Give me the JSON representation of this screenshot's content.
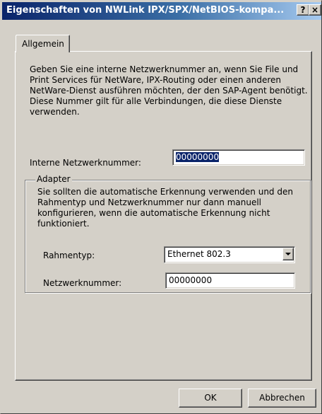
{
  "window": {
    "title": "Eigenschaften von NWLink IPX/SPX/NetBIOS-kompa...",
    "help_button": "?",
    "close_button": "×"
  },
  "tabs": [
    {
      "label": "Allgemein",
      "selected": true
    }
  ],
  "general": {
    "description": "Geben Sie eine interne Netzwerknummer an, wenn Sie File und Print Services für NetWare, IPX-Routing oder einen anderen NetWare-Dienst ausführen möchten, der den SAP-Agent benötigt. Diese Nummer gilt für alle Verbindungen, die diese Dienste verwenden.",
    "internal_network_label": "Interne Netzwerknummer:",
    "internal_network_value": "00000000"
  },
  "adapter": {
    "group_label": "Adapter",
    "description": "Sie sollten die automatische Erkennung verwenden und den Rahmentyp und Netzwerknummer nur dann manuell konfigurieren, wenn die automatische Erkennung nicht funktioniert.",
    "frame_type_label": "Rahmentyp:",
    "frame_type_value": "Ethernet 802.3",
    "network_number_label": "Netzwerknummer:",
    "network_number_value": "00000000"
  },
  "buttons": {
    "ok": "OK",
    "cancel": "Abbrechen"
  },
  "colors": {
    "face": "#d4d0c8",
    "titlebar_start": "#0a246a",
    "titlebar_end": "#a6caf0",
    "selection": "#0a246a"
  }
}
